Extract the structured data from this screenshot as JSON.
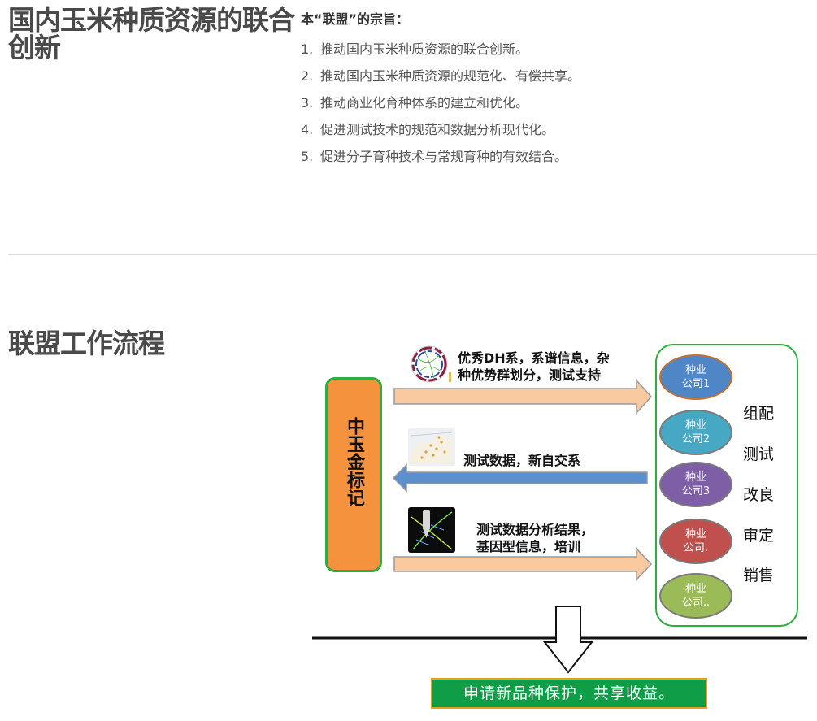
{
  "section1": {
    "heading": "国内玉米种质资源的联合创新",
    "tenets_title": "本“联盟”的宗旨：",
    "tenets": [
      {
        "num": "1.",
        "text": "推动国内玉米种质资源的联合创新。"
      },
      {
        "num": "2.",
        "text": "推动国内玉米种质资源的规范化、有偿共享。"
      },
      {
        "num": "3.",
        "text": "推动商业化育种体系的建立和优化。"
      },
      {
        "num": "4.",
        "text": "促进测试技术的规范和数据分析现代化。"
      },
      {
        "num": "5.",
        "text": "促进分子育种技术与常规育种的有效结合。"
      }
    ]
  },
  "section2": {
    "heading": "联盟工作流程",
    "diagram": {
      "org": "中玉金标记",
      "arrow1_label": [
        "优秀DH系，系谱信息，杂",
        "种优势群划分，测试支持"
      ],
      "arrow2_label": "测试数据，新自交系",
      "arrow3_label": [
        "测试数据分析结果，",
        "基因型信息，培训"
      ],
      "companies": [
        {
          "line1": "种业",
          "line2": "公司1",
          "color": "#4f86c6"
        },
        {
          "line1": "种业",
          "line2": "公司2",
          "color": "#47a8c4"
        },
        {
          "line1": "种业",
          "line2": "公司3",
          "color": "#7e5fa6"
        },
        {
          "line1": "种业",
          "line2": "公司.",
          "color": "#c0504d"
        },
        {
          "line1": "种业",
          "line2": "公司..",
          "color": "#9bbb59"
        }
      ],
      "steps": [
        "组配",
        "测试",
        "改良",
        "审定",
        "销售"
      ],
      "result": "申请新品种保护，共享收益。",
      "colors": {
        "forward_arrow": "#f9c9a0",
        "backward_arrow": "#5b8fd0",
        "org_box": "#f5923e",
        "frame_green": "#2eae3e",
        "result_bg": "#0f9d48"
      }
    }
  }
}
